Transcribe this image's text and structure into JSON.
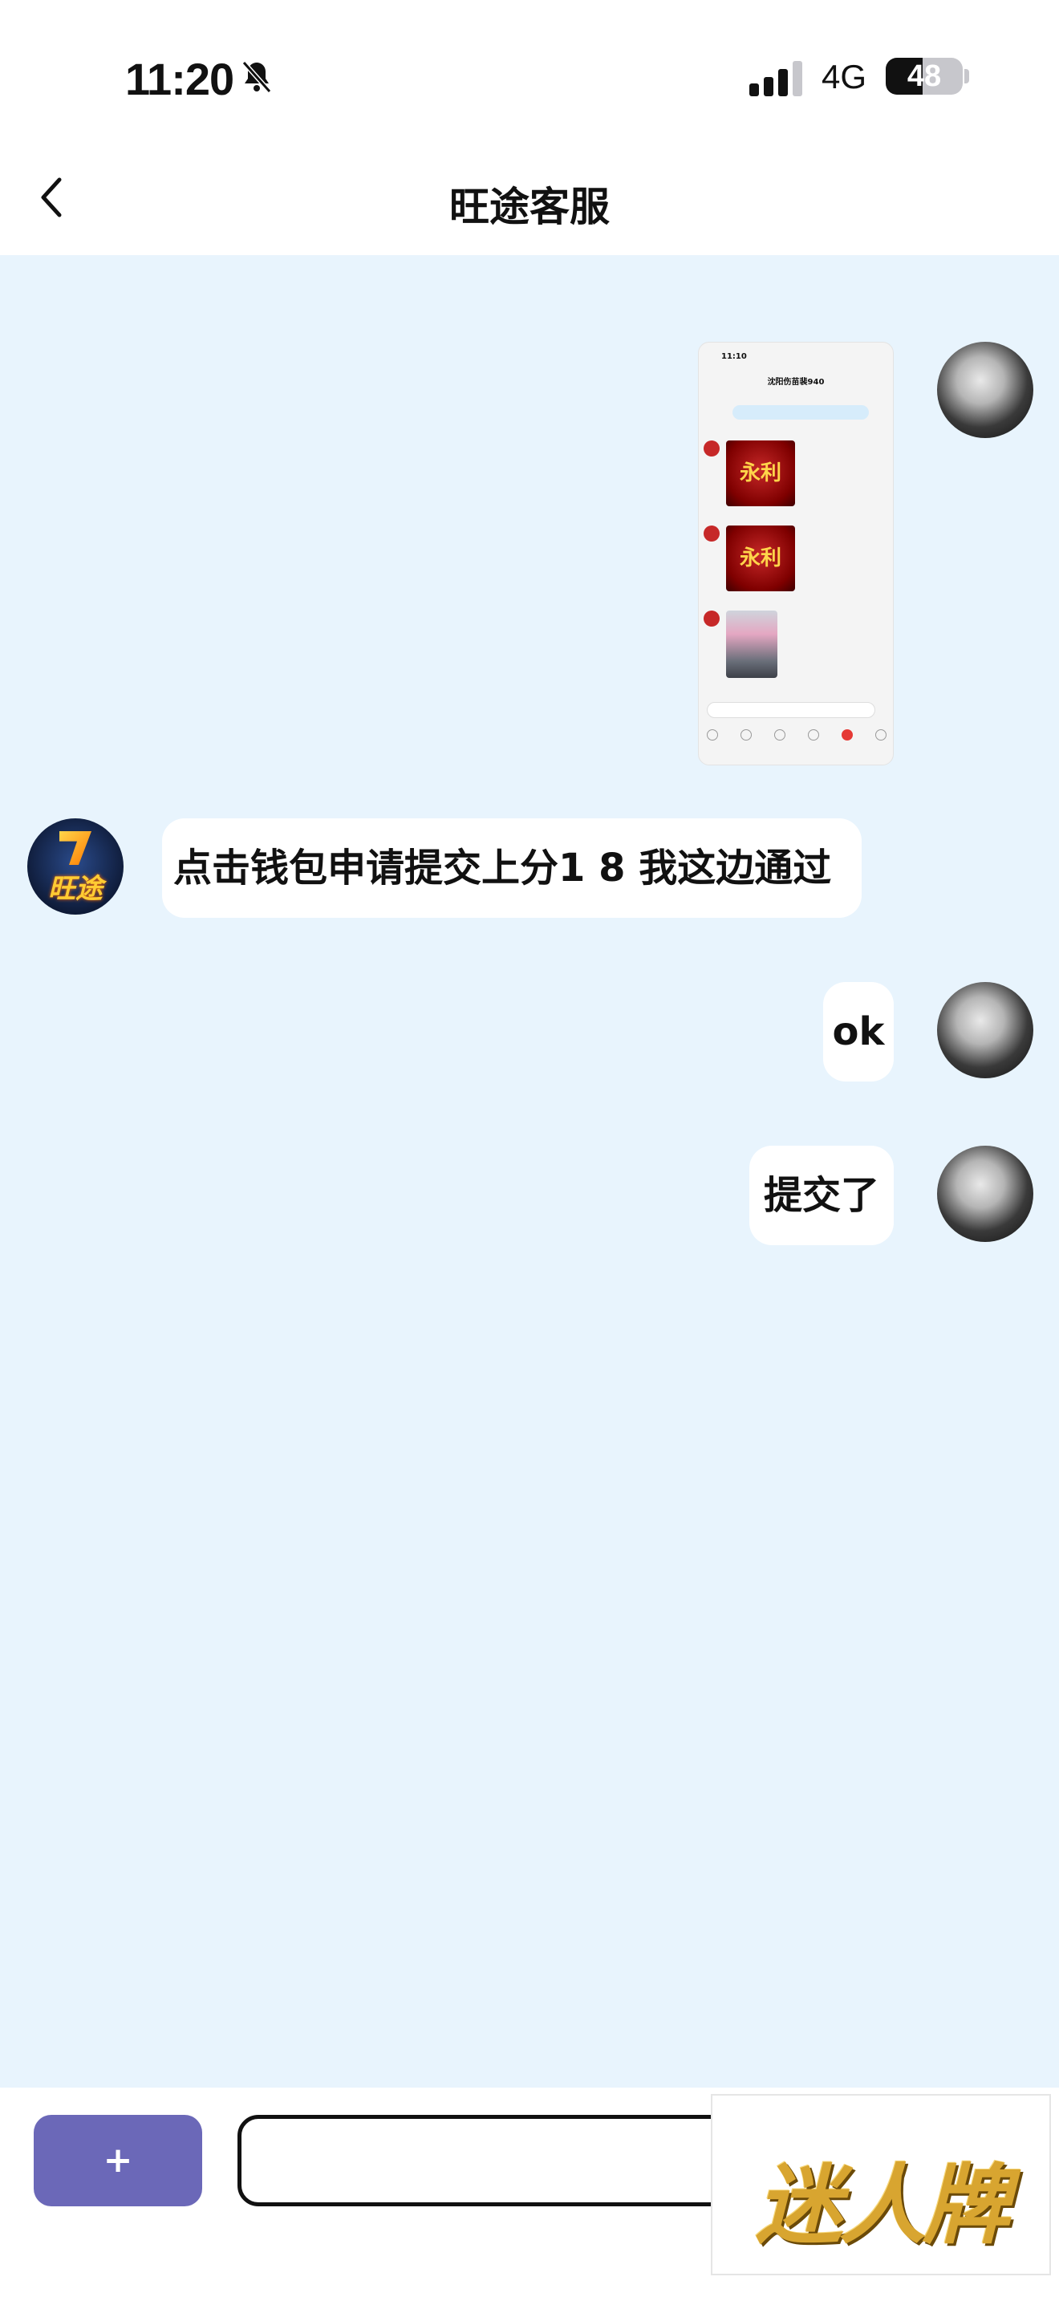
{
  "status_bar": {
    "time": "11:20",
    "network": "4G",
    "battery": "48",
    "battery_level": 0.48
  },
  "header": {
    "title": "旺途客服"
  },
  "messages": [
    {
      "side": "right",
      "type": "image",
      "sender": "user"
    },
    {
      "side": "left",
      "type": "text",
      "sender": "agent",
      "text": "点击钱包申请提交上分1 8 我这边通过"
    },
    {
      "side": "right",
      "type": "text",
      "sender": "user",
      "text": "ok"
    },
    {
      "side": "right",
      "type": "text",
      "sender": "user",
      "text": "提交了"
    }
  ],
  "agent_avatar_text": "旺途",
  "thumbnail": {
    "time": "11:10",
    "title": "沈阳伤苗裴940"
  },
  "input_bar": {
    "plus_label": "+",
    "input_value": ""
  },
  "watermark": {
    "text": "迷人牌"
  },
  "colors": {
    "chat_background": "#e8f4fd",
    "plus_button": "#6b68b8",
    "bubble": "#ffffff"
  }
}
